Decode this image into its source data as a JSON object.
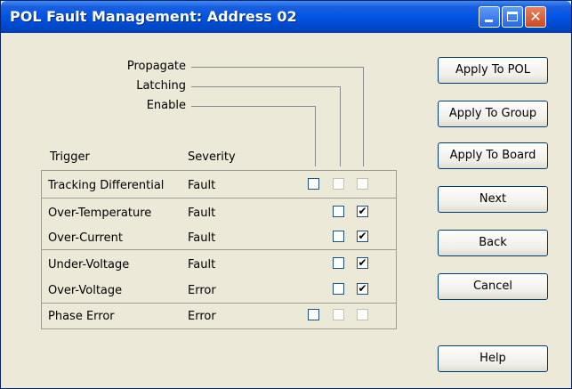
{
  "window": {
    "title": "POL Fault Management: Address 02"
  },
  "labels": {
    "propagate": "Propagate",
    "latching": "Latching",
    "enable": "Enable",
    "trigger_header": "Trigger",
    "severity_header": "Severity"
  },
  "rows": [
    {
      "trigger": "Tracking Differential",
      "severity": "Fault",
      "enable": false,
      "latching": false,
      "propagate": false,
      "enable_available": true,
      "latching_available": false,
      "propagate_available": false
    },
    {
      "trigger": "Over-Temperature",
      "severity": "Fault",
      "latching": false,
      "propagate": true
    },
    {
      "trigger": "Over-Current",
      "severity": "Fault",
      "latching": false,
      "propagate": true
    },
    {
      "trigger": "Under-Voltage",
      "severity": "Fault",
      "latching": false,
      "propagate": true
    },
    {
      "trigger": "Over-Voltage",
      "severity": "Error",
      "latching": false,
      "propagate": true
    },
    {
      "trigger": "Phase Error",
      "severity": "Error",
      "enable": false,
      "latching": false,
      "propagate": false,
      "enable_available": true,
      "latching_available": false,
      "propagate_available": false
    }
  ],
  "buttons": {
    "apply_pol": "Apply To POL",
    "apply_group": "Apply To Group",
    "apply_board": "Apply To Board",
    "next": "Next",
    "back": "Back",
    "cancel": "Cancel",
    "help": "Help"
  },
  "title_buttons": {
    "minimize_icon": "minimize-icon",
    "maximize_icon": "maximize-icon",
    "close_icon": "close-icon"
  },
  "colors": {
    "titlebar": "#0054e3",
    "close_button": "#c94a24",
    "window_bg": "#ece9d8"
  }
}
